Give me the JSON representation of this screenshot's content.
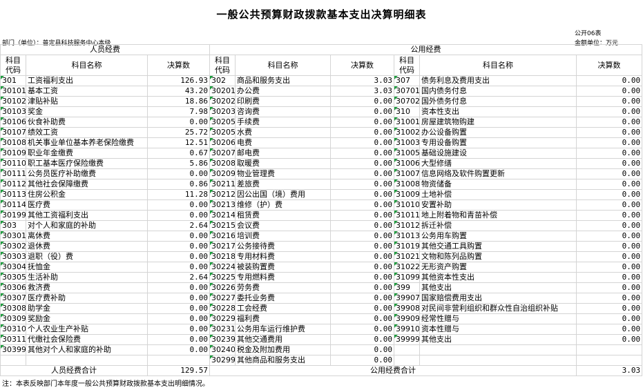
{
  "title": "一般公共预算财政拨款基本支出决算明细表",
  "form_code": "公开06表",
  "department": "部门（单位）：普定县科技服务中心本级",
  "unit": "金额单位：万元",
  "section_personnel": "人员经费",
  "section_public": "公用经费",
  "headers": {
    "code": "科目代码",
    "name": "科目名称",
    "amount": "决算数"
  },
  "rows": [
    {
      "p": [
        "301",
        "工资福利支出",
        "126.93",
        false
      ],
      "q": [
        "302",
        "商品和服务支出",
        "3.03",
        false
      ],
      "r": [
        "307",
        "债务利息及费用支出",
        "0.00",
        false
      ]
    },
    {
      "p": [
        "30101",
        "基本工资",
        "43.20",
        true
      ],
      "q": [
        "30201",
        "办公费",
        "3.03",
        true
      ],
      "r": [
        "30701",
        "国内债务付息",
        "0.00",
        true
      ]
    },
    {
      "p": [
        "30102",
        "津贴补贴",
        "18.86",
        true
      ],
      "q": [
        "30202",
        "印刷费",
        "0.00",
        true
      ],
      "r": [
        "30702",
        "国外债务付息",
        "0.00",
        true
      ]
    },
    {
      "p": [
        "30103",
        "奖金",
        "7.98",
        true
      ],
      "q": [
        "30203",
        "咨询费",
        "0.00",
        true
      ],
      "r": [
        "310",
        "资本性支出",
        "0.00",
        false
      ]
    },
    {
      "p": [
        "30106",
        "伙食补助费",
        "0.00",
        true
      ],
      "q": [
        "30205",
        "手续费",
        "0.00",
        true
      ],
      "r": [
        "31001",
        "房屋建筑物购建",
        "0.00",
        true
      ]
    },
    {
      "p": [
        "30107",
        "绩效工资",
        "25.72",
        true
      ],
      "q": [
        "30205",
        "水费",
        "0.00",
        true
      ],
      "r": [
        "31002",
        "办公设备购置",
        "0.00",
        true
      ]
    },
    {
      "p": [
        "30108",
        "机关事业单位基本养老保险缴费",
        "12.51",
        true
      ],
      "q": [
        "30206",
        "电费",
        "0.00",
        true
      ],
      "r": [
        "31003",
        "专用设备购置",
        "0.00",
        true
      ]
    },
    {
      "p": [
        "30109",
        "职业年金缴费",
        "0.67",
        true
      ],
      "q": [
        "30207",
        "邮电费",
        "0.00",
        true
      ],
      "r": [
        "31005",
        "基础设施建设",
        "0.00",
        true
      ]
    },
    {
      "p": [
        "30110",
        "职工基本医疗保险缴费",
        "5.86",
        true
      ],
      "q": [
        "30208",
        "取暖费",
        "0.00",
        true
      ],
      "r": [
        "31006",
        "大型修缮",
        "0.00",
        true
      ]
    },
    {
      "p": [
        "30111",
        "公务员医疗补助缴费",
        "0.00",
        true
      ],
      "q": [
        "30209",
        "物业管理费",
        "0.00",
        true
      ],
      "r": [
        "31007",
        "信息网络及软件购置更新",
        "0.00",
        true
      ]
    },
    {
      "p": [
        "30112",
        "其他社会保障缴费",
        "0.86",
        true
      ],
      "q": [
        "30211",
        "差旅费",
        "0.00",
        true
      ],
      "r": [
        "31008",
        "物资储备",
        "0.00",
        true
      ]
    },
    {
      "p": [
        "30113",
        "住房公积金",
        "11.28",
        true
      ],
      "q": [
        "30212",
        "因公出国（境）费用",
        "0.00",
        true
      ],
      "r": [
        "31009",
        "土地补偿",
        "0.00",
        true
      ]
    },
    {
      "p": [
        "30114",
        "医疗费",
        "0.00",
        true
      ],
      "q": [
        "30213",
        "维修（护）费",
        "0.00",
        true
      ],
      "r": [
        "31010",
        "安置补助",
        "0.00",
        true
      ]
    },
    {
      "p": [
        "30199",
        "其他工资福利支出",
        "0.00",
        true
      ],
      "q": [
        "30214",
        "租赁费",
        "0.00",
        true
      ],
      "r": [
        "31011",
        "地上附着物和青苗补偿",
        "0.00",
        true
      ]
    },
    {
      "p": [
        "303",
        "对个人和家庭的补助",
        "2.64",
        false
      ],
      "q": [
        "30215",
        "会议费",
        "0.00",
        true
      ],
      "r": [
        "31012",
        "拆迁补偿",
        "0.00",
        true
      ]
    },
    {
      "p": [
        "30301",
        "离休费",
        "0.00",
        true
      ],
      "q": [
        "30216",
        "培训费",
        "0.00",
        true
      ],
      "r": [
        "31013",
        "公务用车购置",
        "0.00",
        true
      ]
    },
    {
      "p": [
        "30302",
        "退休费",
        "0.00",
        true
      ],
      "q": [
        "30217",
        "公务接待费",
        "0.00",
        true
      ],
      "r": [
        "31019",
        "其他交通工具购置",
        "0.00",
        true
      ]
    },
    {
      "p": [
        "30303",
        "退职（役）费",
        "0.00",
        true
      ],
      "q": [
        "30218",
        "专用材料费",
        "0.00",
        true
      ],
      "r": [
        "31021",
        "文物和陈列品购置",
        "0.00",
        true
      ]
    },
    {
      "p": [
        "30304",
        "抚恤金",
        "0.00",
        true
      ],
      "q": [
        "30224",
        "被装购置费",
        "0.00",
        true
      ],
      "r": [
        "31022",
        "无形资产购置",
        "0.00",
        true
      ]
    },
    {
      "p": [
        "30305",
        "生活补助",
        "2.64",
        true
      ],
      "q": [
        "30225",
        "专用燃料费",
        "0.00",
        true
      ],
      "r": [
        "31099",
        "其他资本性支出",
        "0.00",
        true
      ]
    },
    {
      "p": [
        "30306",
        "救济费",
        "0.00",
        true
      ],
      "q": [
        "30226",
        "劳务费",
        "0.00",
        true
      ],
      "r": [
        "399",
        "其他支出",
        "0.00",
        false
      ]
    },
    {
      "p": [
        "30307",
        "医疗费补助",
        "0.00",
        true
      ],
      "q": [
        "30227",
        "委托业务费",
        "0.00",
        true
      ],
      "r": [
        "39907",
        "国家赔偿费用支出",
        "0.00",
        true
      ]
    },
    {
      "p": [
        "30308",
        "助学金",
        "0.00",
        true
      ],
      "q": [
        "30228",
        "工会经费",
        "0.00",
        true
      ],
      "r": [
        "39908",
        "对民间非营利组织和群众性自治组织补贴",
        "0.00",
        true
      ]
    },
    {
      "p": [
        "30309",
        "奖励金",
        "0.00",
        true
      ],
      "q": [
        "30229",
        "福利费",
        "0.00",
        true
      ],
      "r": [
        "39909",
        "经常性赠与",
        "0.00",
        true
      ]
    },
    {
      "p": [
        "30310",
        "个人农业生产补贴",
        "0.00",
        true
      ],
      "q": [
        "30231",
        "公务用车运行维护费",
        "0.00",
        true
      ],
      "r": [
        "39910",
        "资本性赠与",
        "0.00",
        true
      ]
    },
    {
      "p": [
        "30311",
        "代缴社会保险费",
        "0.00",
        true
      ],
      "q": [
        "30239",
        "其他交通费用",
        "0.00",
        true
      ],
      "r": [
        "39999",
        "其他支出",
        "0.00",
        true
      ]
    },
    {
      "p": [
        "30399",
        "其他对个人和家庭的补助",
        "0.00",
        true
      ],
      "q": [
        "30240",
        "税金及附加费用",
        "0.00",
        true
      ],
      "r": [
        "",
        "",
        "",
        false
      ]
    },
    {
      "p": [
        "",
        "",
        "",
        false
      ],
      "q": [
        "30299",
        "其他商品和服务支出",
        "0.00",
        true
      ],
      "r": [
        "",
        "",
        "",
        false
      ]
    }
  ],
  "personnel_total_label": "人员经费合计",
  "personnel_total": "129.57",
  "public_total_label": "公用经费合计",
  "public_total": "3.03",
  "note": "注：本表反映部门本年度一般公共预算财政拨款基本支出明细情况。"
}
